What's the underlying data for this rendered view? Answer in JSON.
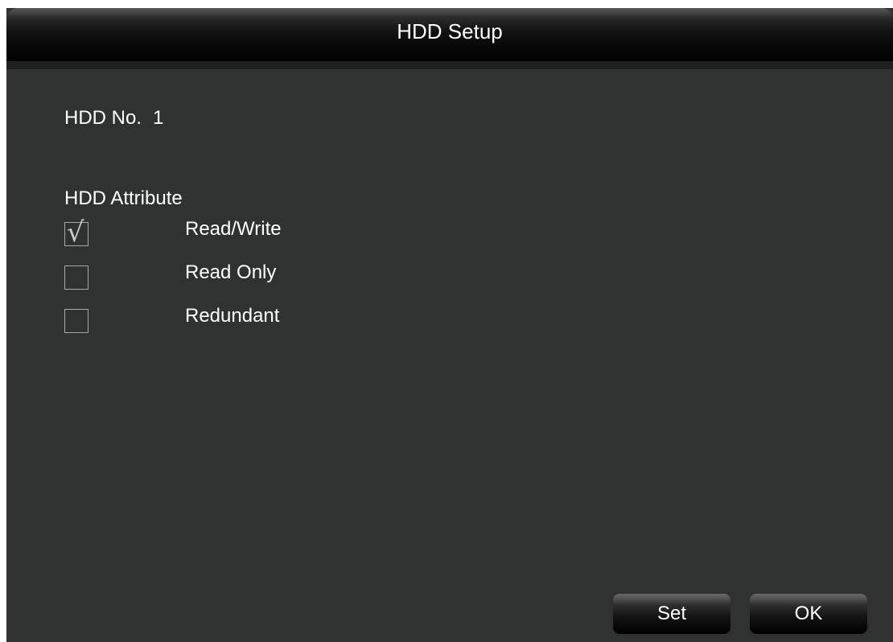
{
  "window": {
    "title": "HDD Setup"
  },
  "hdd": {
    "number_label": "HDD No.",
    "number_value": "1"
  },
  "attribute": {
    "heading": "HDD Attribute",
    "options": [
      {
        "label": "Read/Write",
        "checked": true,
        "mark": "√"
      },
      {
        "label": "Read Only",
        "checked": false,
        "mark": ""
      },
      {
        "label": "Redundant",
        "checked": false,
        "mark": ""
      }
    ]
  },
  "buttons": {
    "set_label": "Set",
    "ok_label": "OK"
  },
  "colors": {
    "panel_background": "#2f3230",
    "text": "#ffffff",
    "checkbox_border": "#a7aaa8"
  }
}
